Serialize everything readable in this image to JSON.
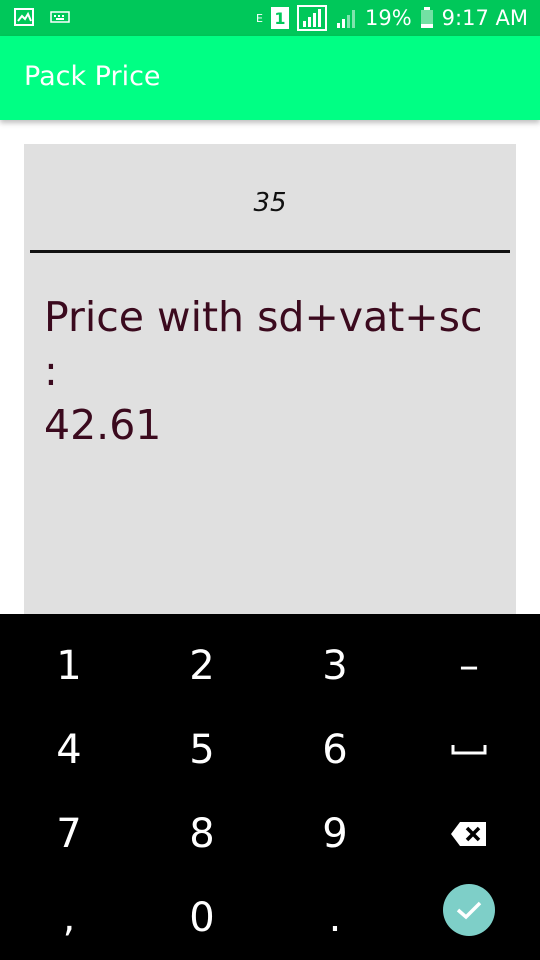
{
  "status": {
    "battery": "19%",
    "time": "9:17 AM",
    "sim": "1",
    "network": "E"
  },
  "app_bar": {
    "title": "Pack Price",
    "color": "#00ff84"
  },
  "form": {
    "input_value": "35",
    "result_label": "Price with sd+vat+sc :",
    "result_value": "42.61"
  },
  "keyboard": {
    "rows": [
      [
        "1",
        "2",
        "3",
        "–"
      ],
      [
        "4",
        "5",
        "6",
        "space-icon"
      ],
      [
        "7",
        "8",
        "9",
        "backspace-icon"
      ],
      [
        ",",
        "0",
        ".",
        "done-check-icon"
      ]
    ],
    "done_color": "#7ecfc8"
  }
}
